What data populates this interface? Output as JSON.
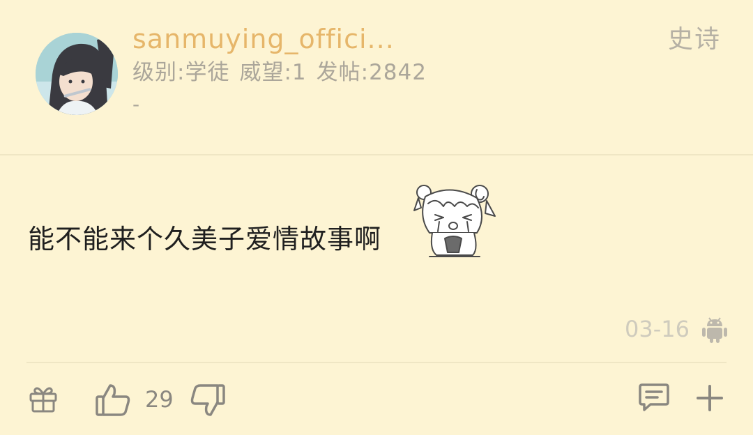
{
  "user": {
    "name": "sanmuying_offici...",
    "level_label": "级别:学徒",
    "reputation_label": "威望:1",
    "posts_label": "发帖:2842",
    "signature": "-",
    "rank": "史诗"
  },
  "post": {
    "content": "能不能来个久美子爱情故事啊",
    "sticker": "crying-girl-sticker",
    "date": "03-16",
    "device_icon": "android-icon"
  },
  "actions": {
    "like_count": "29",
    "icons": [
      "gift-icon",
      "thumbs-up-icon",
      "thumbs-down-icon",
      "comment-icon",
      "plus-icon"
    ]
  },
  "colors": {
    "background": "#fdf4d3",
    "username": "#e6b66a",
    "meta_text": "#aba69a",
    "content_text": "#1f1f1f",
    "icon": "#8a8780"
  }
}
